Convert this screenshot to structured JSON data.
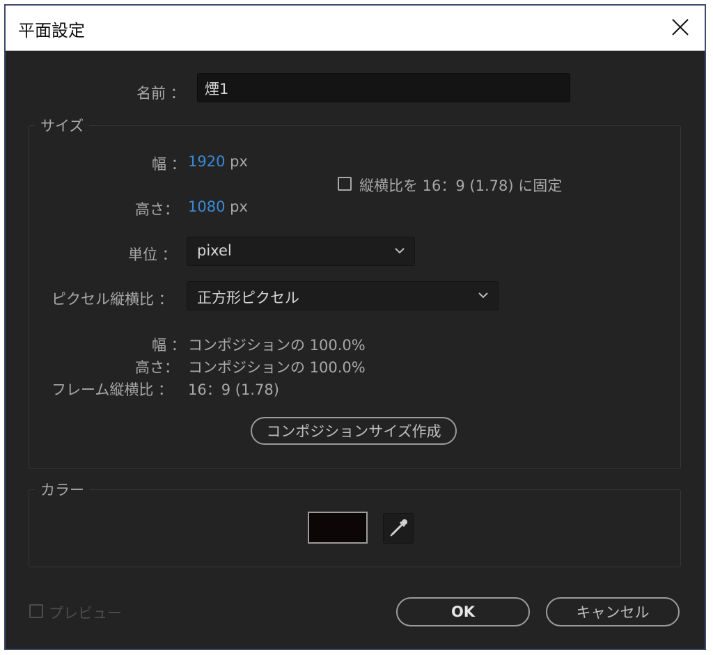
{
  "window": {
    "title": "平面設定",
    "close_icon": "close-icon"
  },
  "name_field": {
    "label": "名前 ：",
    "value": "煙1"
  },
  "size_group": {
    "legend": "サイズ",
    "width_label": "幅 ：",
    "width_value": "1920",
    "width_unit": "px",
    "height_label": "高さ：",
    "height_value": "1080",
    "height_unit": "px",
    "lock_aspect_label": "縦横比を 16：9 (1.78) に固定",
    "lock_aspect_checked": false,
    "units_label": "単位 ：",
    "units_value": "pixel",
    "pixel_aspect_label": "ピクセル縦横比 ：",
    "pixel_aspect_value": "正方形ピクセル",
    "info_width_label": "幅 ：",
    "info_width_value": "コンポジションの 100.0%",
    "info_height_label": "高さ：",
    "info_height_value": "コンポジションの 100.0%",
    "info_frame_label": "フレーム縦横比 ：",
    "info_frame_value": "16：9 (1.78)",
    "make_comp_size_button": "コンポジションサイズ作成"
  },
  "color_group": {
    "legend": "カラー",
    "swatch_color": "#0c0606",
    "eyedropper_icon": "eyedropper-icon"
  },
  "footer": {
    "preview_label": "プレビュー",
    "preview_checked": false,
    "ok_button": "OK",
    "cancel_button": "キャンセル"
  },
  "colors": {
    "dialog_bg": "#232323",
    "value_blue": "#3a8ad6",
    "text_gray": "#a9a9a9"
  }
}
